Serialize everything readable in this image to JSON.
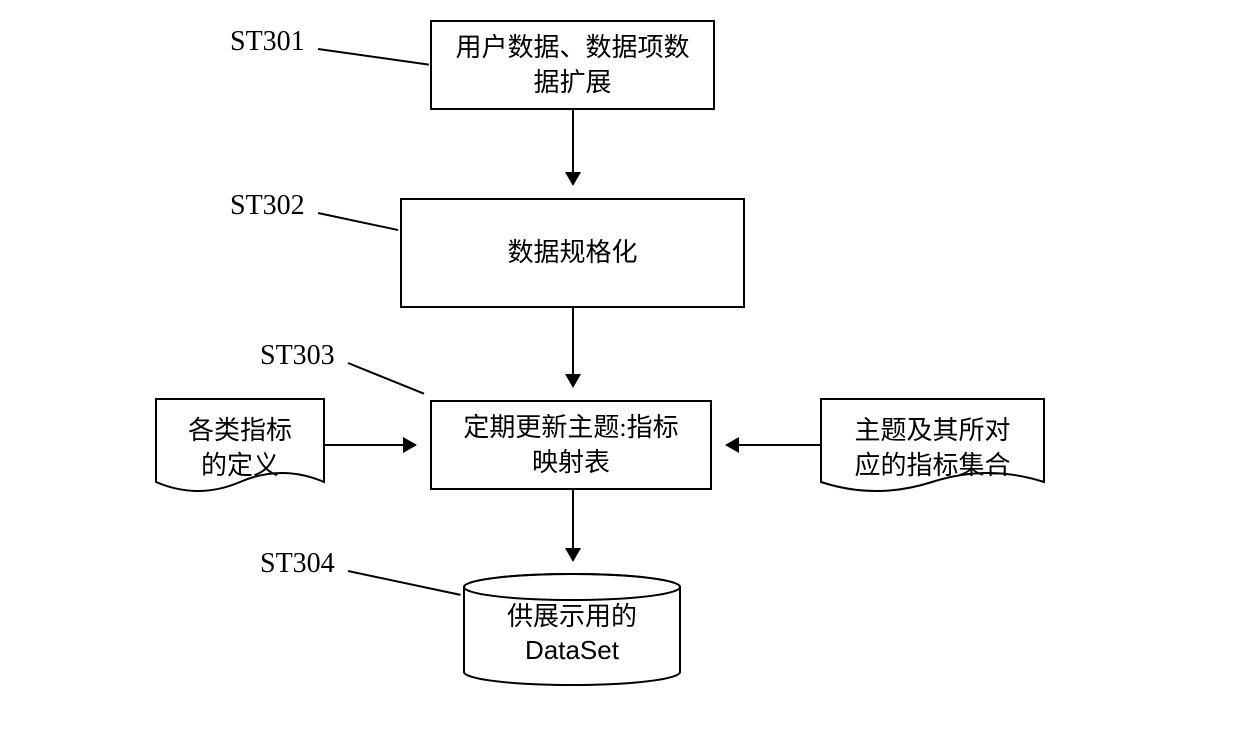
{
  "labels": {
    "st301": "ST301",
    "st302": "ST302",
    "st303": "ST303",
    "st304": "ST304"
  },
  "boxes": {
    "b1_l1": "用户数据、数据项数",
    "b1_l2": "据扩展",
    "b2": "数据规格化",
    "b3_l1": "定期更新主题:指标",
    "b3_l2": "映射表"
  },
  "docs": {
    "left_l1": "各类指标",
    "left_l2": "的定义",
    "right_l1": "主题及其所对",
    "right_l2": "应的指标集合"
  },
  "cylinder": {
    "line1": "供展示用的",
    "line2": "DataSet"
  }
}
